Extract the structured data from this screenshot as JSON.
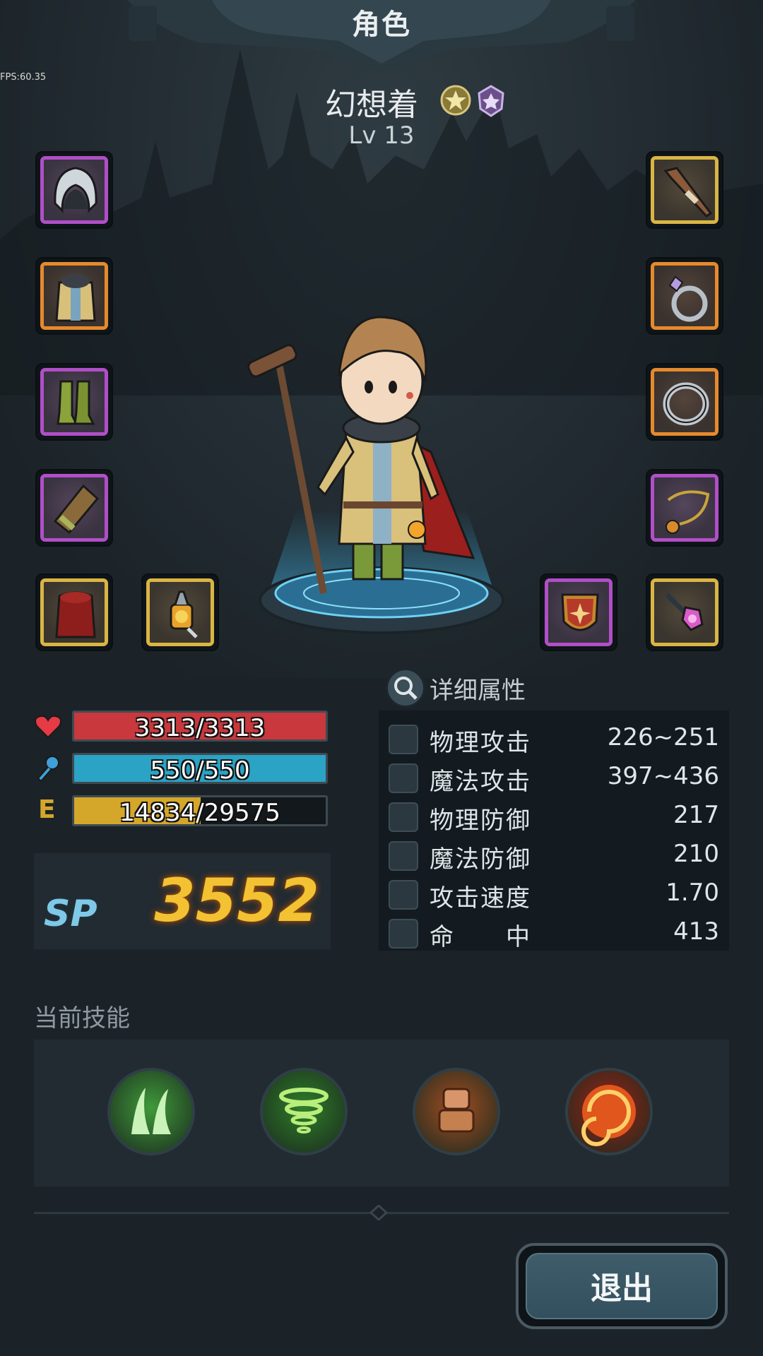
{
  "header": {
    "title": "角色"
  },
  "debug": {
    "fps": "FPS:60.35"
  },
  "character": {
    "name": "幻想着",
    "level": "Lv 13",
    "badges": [
      "gold-rank-badge-icon",
      "purple-rank-badge-icon"
    ]
  },
  "equipment": {
    "left": [
      {
        "icon": "hood-icon",
        "rarity": "purple"
      },
      {
        "icon": "robe-icon",
        "rarity": "orange"
      },
      {
        "icon": "boots-icon",
        "rarity": "purple"
      },
      {
        "icon": "bracer-icon",
        "rarity": "purple"
      },
      {
        "icon": "cloak-icon",
        "rarity": "gold"
      },
      {
        "icon": "amulet-gem-icon",
        "rarity": "gold"
      }
    ],
    "right": [
      {
        "icon": "staff-icon",
        "rarity": "gold"
      },
      {
        "icon": "gem-ring-icon",
        "rarity": "orange"
      },
      {
        "icon": "ring-icon",
        "rarity": "orange"
      },
      {
        "icon": "necklace-icon",
        "rarity": "purple"
      },
      {
        "icon": "shield-icon",
        "rarity": "purple"
      },
      {
        "icon": "wand-icon",
        "rarity": "gold"
      }
    ]
  },
  "stats": {
    "hp": {
      "text": "3313/3313",
      "fill": 1.0,
      "color": "#c8383c"
    },
    "mp": {
      "text": "550/550",
      "fill": 1.0,
      "color": "#2aa3c4"
    },
    "exp": {
      "label": "E",
      "text": "14834/29575",
      "fill": 0.5016,
      "color": "#d4a62a"
    }
  },
  "sp": {
    "label": "SP",
    "value": "3552"
  },
  "details": {
    "title": "详细属性",
    "rows": [
      {
        "icon": "sword-icon",
        "name": "物理攻击",
        "value": "226~251"
      },
      {
        "icon": "magic-wand-icon",
        "name": "魔法攻击",
        "value": "397~436"
      },
      {
        "icon": "shield-icon",
        "name": "物理防御",
        "value": "217"
      },
      {
        "icon": "sparkle-icon",
        "name": "魔法防御",
        "value": "210"
      },
      {
        "icon": "speed-icon",
        "name": "攻击速度",
        "value": "1.70"
      },
      {
        "icon": "target-icon",
        "name": "命　　中",
        "value": "413"
      }
    ]
  },
  "skills": {
    "title": "当前技能",
    "items": [
      {
        "icon": "wind-claw-skill-icon",
        "color": "#3f9a3a"
      },
      {
        "icon": "tornado-skill-icon",
        "color": "#2f7d2a"
      },
      {
        "icon": "stone-golem-skill-icon",
        "color": "#a14d22"
      },
      {
        "icon": "fire-vortex-skill-icon",
        "color": "#9c2316"
      }
    ]
  },
  "exit_button": {
    "label": "退出"
  }
}
